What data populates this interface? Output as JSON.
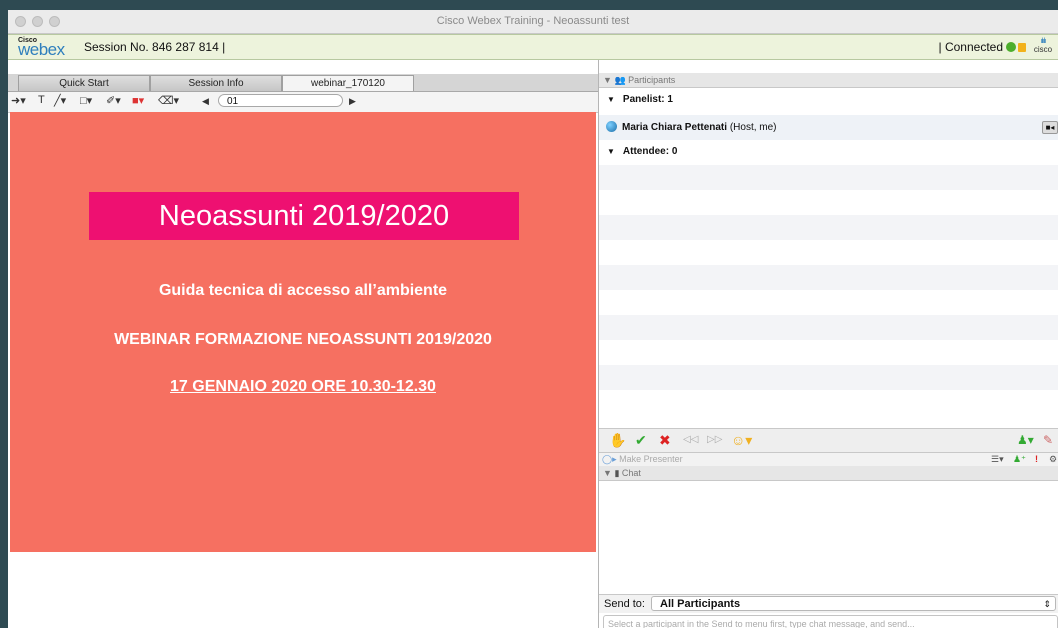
{
  "window": {
    "title": "Cisco Webex Training - Neoassunti test"
  },
  "session_bar": {
    "brand_small": "Cisco",
    "brand": "webex",
    "session_text": "Session No. 846 287 814 |",
    "status_text": "| Connected",
    "cisco_mark": "cisco"
  },
  "tabs": [
    {
      "label": "Quick Start"
    },
    {
      "label": "Session Info"
    },
    {
      "label": "webinar_170120"
    }
  ],
  "annotation_tools": {
    "arrow": "➜▾",
    "text": "T",
    "pen": "╱▾",
    "shape": "□▾",
    "highlighter": "✐▾",
    "color": "■▾",
    "eraser": "⌫▾",
    "page_value": "01"
  },
  "slide": {
    "title": "Neoassunti 2019/2020",
    "line1": "Guida tecnica di accesso all’ambiente",
    "line2": "WEBINAR FORMAZIONE NEOASSUNTI 2019/2020",
    "line3": "17 GENNAIO 2020 ORE 10.30-12.30"
  },
  "participants_panel": {
    "header": "Participants",
    "panelist_group": "Panelist: 1",
    "participant_name": "Maria Chiara Pettenati",
    "participant_role": "(Host, me)",
    "attendee_group": "Attendee: 0"
  },
  "presenter_bar": {
    "label": "Make Presenter"
  },
  "chat_panel": {
    "header": "Chat",
    "send_to_label": "Send to:",
    "send_to_value": "All Participants",
    "input_placeholder": "Select a participant in the Send to menu first, type chat message, and send..."
  },
  "colors": {
    "slide_bg": "#f67061",
    "title_bg": "#ee1071",
    "session_bar": "#edf3dc"
  }
}
